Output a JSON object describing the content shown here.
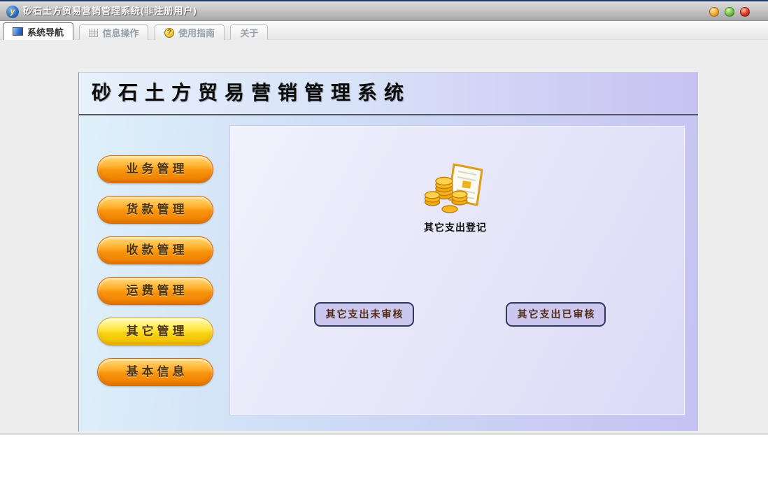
{
  "titlebar": {
    "app_title": "砂石土方贸易营销管理系统(非注册用户)",
    "app_icon_glyph": "y",
    "controls": [
      {
        "name": "minimize",
        "color": "#f2a62c"
      },
      {
        "name": "maximize",
        "color": "#74c045"
      },
      {
        "name": "close",
        "color": "#da3525"
      }
    ]
  },
  "tabs": [
    {
      "label": "系统导航",
      "icon": "blue-square-icon",
      "active": true
    },
    {
      "label": "信息操作",
      "icon": "grid-icon",
      "active": false
    },
    {
      "label": "使用指南",
      "icon": "help-coin-icon",
      "active": false
    },
    {
      "label": "关于",
      "icon": "",
      "active": false
    }
  ],
  "banner": {
    "title": "砂石土方贸易营销管理系统"
  },
  "sidebar": {
    "items": [
      {
        "label": "业务管理",
        "state": "normal"
      },
      {
        "label": "货款管理",
        "state": "normal"
      },
      {
        "label": "收款管理",
        "state": "normal"
      },
      {
        "label": "运费管理",
        "state": "normal"
      },
      {
        "label": "其它管理",
        "state": "selected"
      },
      {
        "label": "基本信息",
        "state": "normal"
      }
    ]
  },
  "main": {
    "feature": {
      "icon": "coins-document-icon",
      "label": "其它支出登记"
    },
    "action_buttons": [
      {
        "label": "其它支出未审核"
      },
      {
        "label": "其它支出已审核"
      }
    ]
  },
  "help_icon_glyph": "?",
  "colors": {
    "menu_button_orange": "#f8940c",
    "menu_button_selected_yellow": "#f8d312",
    "panel_lavender": "#e6e5f9",
    "action_button_fill": "#cbc7ef",
    "action_button_border": "#2e3a5c",
    "banner_gradient_left": "#e7f0fb",
    "banner_gradient_right": "#c7c1f2"
  }
}
